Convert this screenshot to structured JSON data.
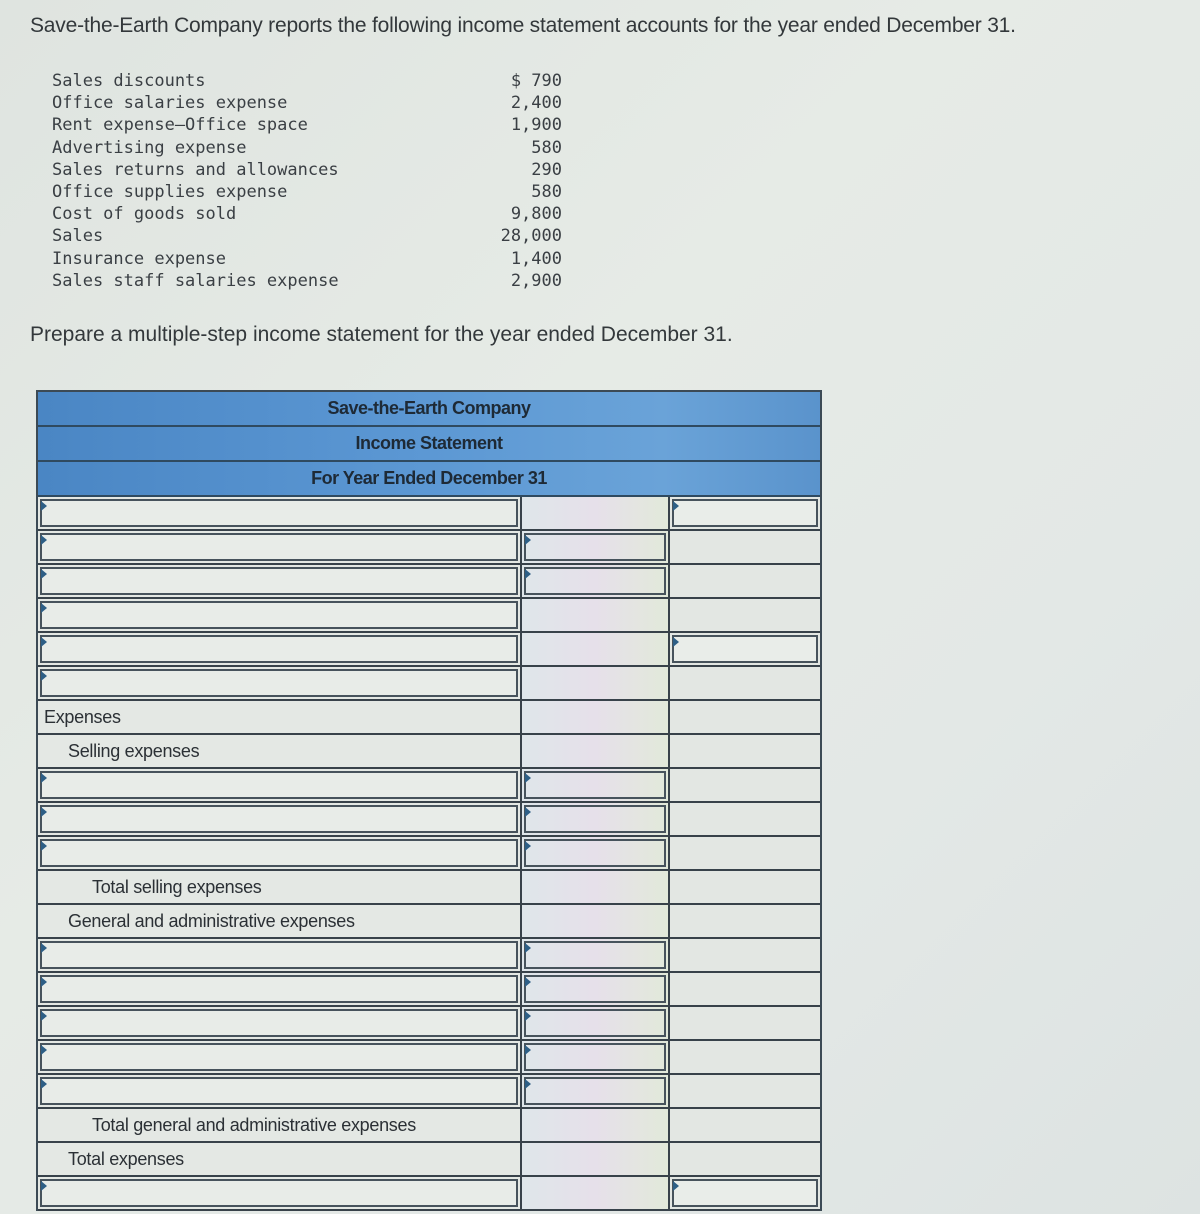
{
  "intro": "Save-the-Earth Company reports the following income statement accounts for the year ended December 31.",
  "accounts": [
    {
      "name": "Sales discounts",
      "amount": "$ 790"
    },
    {
      "name": "Office salaries expense",
      "amount": "2,400"
    },
    {
      "name": "Rent expense—Office space",
      "amount": "1,900"
    },
    {
      "name": "Advertising expense",
      "amount": "580"
    },
    {
      "name": "Sales returns and allowances",
      "amount": "290"
    },
    {
      "name": "Office supplies expense",
      "amount": "580"
    },
    {
      "name": "Cost of goods sold",
      "amount": "9,800"
    },
    {
      "name": "Sales",
      "amount": "28,000"
    },
    {
      "name": "Insurance expense",
      "amount": "1,400"
    },
    {
      "name": "Sales staff salaries expense",
      "amount": "2,900"
    }
  ],
  "instruction": "Prepare a multiple-step income statement for the year ended December 31.",
  "statement": {
    "company": "Save-the-Earth Company",
    "title": "Income Statement",
    "period": "For Year Ended December 31",
    "labels": {
      "expenses": "Expenses",
      "selling_expenses": "Selling expenses",
      "total_selling_expenses": "Total selling expenses",
      "general_admin_expenses": "General and administrative expenses",
      "total_general_admin_expenses": "Total general and administrative expenses",
      "total_expenses": "Total expenses"
    },
    "inputs": {
      "value": "",
      "placeholder": ""
    }
  },
  "colors": {
    "header_blue": "#5c98d4",
    "input_marker": "#2e5f86"
  }
}
